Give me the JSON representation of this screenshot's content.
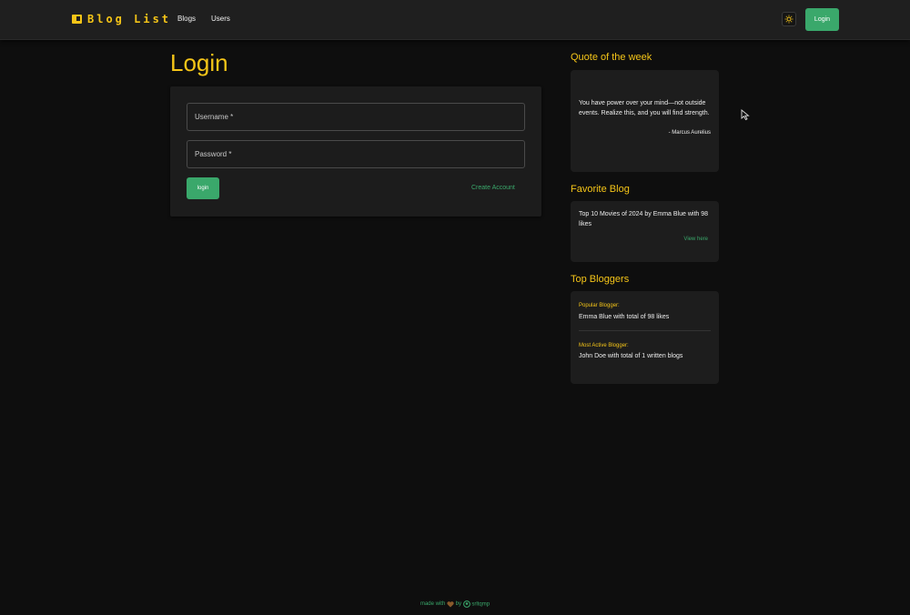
{
  "navbar": {
    "brand": "Blog List",
    "links": [
      "Blogs",
      "Users"
    ],
    "theme_icon": "sun-icon",
    "login_label": "Login"
  },
  "login": {
    "title": "Login",
    "username_label": "Username *",
    "password_label": "Password *",
    "submit_label": "login",
    "create_account_label": "Create Account"
  },
  "sidebar": {
    "quote": {
      "heading": "Quote of the week",
      "text": "You have power over your mind—not outside events. Realize this, and you will find strength.",
      "author": "- Marcus Aurelius"
    },
    "favorite": {
      "heading": "Favorite Blog",
      "text": "Top 10 Movies of 2024 by Emma Blue with 98 likes",
      "link_label": "View here"
    },
    "top_bloggers": {
      "heading": "Top Bloggers",
      "popular_label": "Popular Blogger:",
      "popular_value": "Emma Blue with total of 98 likes",
      "active_label": "Most Active Blogger:",
      "active_value": "John Doe with total of 1 written blogs"
    }
  },
  "footer": {
    "made_with": "made with",
    "by": "by",
    "author": "srltqmp",
    "heart_icon": "heart-icon",
    "github_icon": "github-icon"
  },
  "colors": {
    "accent": "#f5c518",
    "button": "#3aa86b",
    "background": "#0e0e0e",
    "card": "#1c1c1c"
  }
}
